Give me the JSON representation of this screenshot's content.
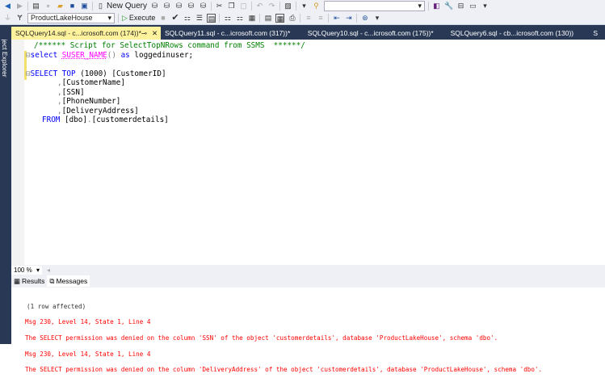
{
  "toolbar": {
    "new_query": "New Query",
    "database": "ProductLakeHouse",
    "execute": "Execute"
  },
  "tabs": [
    {
      "label": "SQLQuery14.sql - c...icrosoft.com (174))*",
      "pin": "⊸",
      "close": "✕"
    },
    {
      "label": "SQLQuery11.sql - c...icrosoft.com (317))*"
    },
    {
      "label": "SQLQuery10.sql - c...icrosoft.com (175))*"
    },
    {
      "label": "SQLQuery6.sql - cb...icrosoft.com (130))"
    },
    {
      "label": "S"
    }
  ],
  "object_explorer": "Object Explorer",
  "code": {
    "l1": "/****** Script for SelectTopNRows command from SSMS  ******/",
    "l2a": "select ",
    "l2b": "SUSER_NAME",
    "l2c": "() ",
    "l2d": "as ",
    "l2e": "loggedinuser;",
    "l4a": "SELECT TOP ",
    "l4b": "(1000) ",
    "l4c": "[CustomerID]",
    "l5": "[CustomerName]",
    "l6": "[SSN]",
    "l7": "[PhoneNumber]",
    "l8": "[DeliveryAddress]",
    "l9a": "FROM ",
    "l9b": "[dbo]",
    "l9c": ".",
    "l9d": "[customerdetails]"
  },
  "zoom": "100 %",
  "results_tabs": {
    "results": "Results",
    "messages": "Messages"
  },
  "messages": [
    "(1 row affected)",
    "Msg 230, Level 14, State 1, Line 4",
    "The SELECT permission was denied on the column 'SSN' of the object 'customerdetails', database 'ProductLakeHouse', schema 'dbo'.",
    "Msg 230, Level 14, State 1, Line 4",
    "The SELECT permission was denied on the column 'DeliveryAddress' of the object 'customerdetails', database 'ProductLakeHouse', schema 'dbo'."
  ]
}
